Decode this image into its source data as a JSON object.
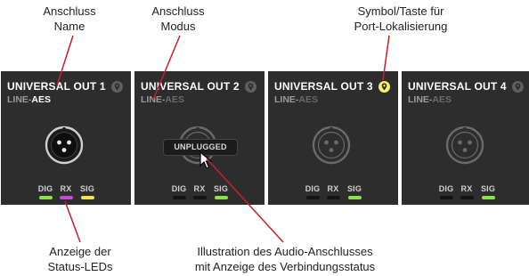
{
  "callouts": {
    "name": [
      "Anschluss",
      "Name"
    ],
    "mode": [
      "Anschluss",
      "Modus"
    ],
    "locate": [
      "Symbol/Taste für",
      "Port-Lokalisierung"
    ],
    "leds": [
      "Anzeige der",
      "Status-LEDs"
    ],
    "illustration": [
      "Illustration des Audio-Anschlusses",
      "mit Anzeige des Verbindungsstatus"
    ]
  },
  "panels": [
    {
      "title": "UNIVERSAL OUT 1",
      "mode_line": "LINE",
      "mode_sep": "-",
      "mode_aes": "AES",
      "aes_active": true,
      "locate_active": false,
      "locate_icon": "location-pin-icon",
      "connector": "xlr-connector-icon",
      "connected": true,
      "overlay": "",
      "leds": [
        {
          "label": "DIG",
          "color": "#8ce24b"
        },
        {
          "label": "RX",
          "color": "#c34bd6"
        },
        {
          "label": "SIG",
          "color": "#efe451"
        }
      ]
    },
    {
      "title": "UNIVERSAL OUT 2",
      "mode_line": "LINE",
      "mode_sep": "-",
      "mode_aes": "AES",
      "aes_active": false,
      "locate_active": false,
      "locate_icon": "location-pin-icon",
      "connector": "xlr-connector-icon",
      "connected": false,
      "overlay": "UNPLUGGED",
      "leds": [
        {
          "label": "DIG",
          "color": "off"
        },
        {
          "label": "RX",
          "color": "off"
        },
        {
          "label": "SIG",
          "color": "#8ce24b"
        }
      ]
    },
    {
      "title": "UNIVERSAL OUT 3",
      "mode_line": "LINE",
      "mode_sep": "-",
      "mode_aes": "AES",
      "aes_active": false,
      "locate_active": true,
      "locate_icon": "location-pin-icon",
      "connector": "xlr-connector-icon",
      "connected": false,
      "overlay": "",
      "leds": [
        {
          "label": "DIG",
          "color": "off"
        },
        {
          "label": "RX",
          "color": "off"
        },
        {
          "label": "SIG",
          "color": "#8ce24b"
        }
      ]
    },
    {
      "title": "UNIVERSAL OUT 4",
      "mode_line": "LINE",
      "mode_sep": "-",
      "mode_aes": "AES",
      "aes_active": false,
      "locate_active": false,
      "locate_icon": "location-pin-icon",
      "connector": "xlr-connector-icon",
      "connected": false,
      "overlay": "",
      "leds": [
        {
          "label": "DIG",
          "color": "off"
        },
        {
          "label": "RX",
          "color": "off"
        },
        {
          "label": "SIG",
          "color": "#8ce24b"
        }
      ]
    }
  ],
  "colors": {
    "panel_bg": "#2d2d2d",
    "led_green": "#8ce24b",
    "led_purple": "#c34bd6",
    "led_yellow": "#efe451",
    "locate_active": "#f7f06a",
    "leader_line": "#c8202a"
  }
}
